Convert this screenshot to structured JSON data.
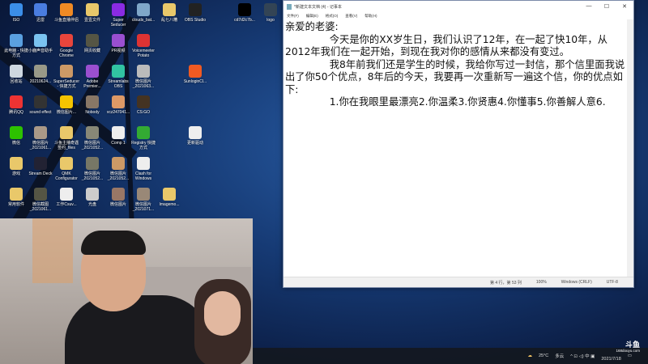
{
  "desktop": {
    "icons": [
      {
        "label": "ISO",
        "c": "#3b8ee8"
      },
      {
        "label": "迅雷",
        "c": "#4a7de0"
      },
      {
        "label": "斗鱼直播伴侣",
        "c": "#f08a24"
      },
      {
        "label": "壹壹文件",
        "c": "#e9c86a"
      },
      {
        "label": "Super Seducer",
        "c": "#8a2be2"
      },
      {
        "label": "clouds_bat...",
        "c": "#7fa7c9"
      },
      {
        "label": "乱七八糟",
        "c": "#e9c86a"
      },
      {
        "label": "OBS Studio",
        "c": "#222"
      },
      {
        "label": "cd7d2c7b...",
        "c": "#000"
      },
      {
        "label": "logo",
        "c": "#345"
      },
      {
        "label": "此电脑 - 快捷方式",
        "c": "#5aa0e0"
      },
      {
        "label": "小鹿声音助手",
        "c": "#7ac3f0"
      },
      {
        "label": "Google Chrome",
        "c": "#e8453c"
      },
      {
        "label": "网页收藏",
        "c": "#554"
      },
      {
        "label": "PR视频",
        "c": "#9a4fd0"
      },
      {
        "label": "Voicemeeter Potato",
        "c": "#d33"
      },
      {
        "label": "回收站",
        "c": "#cfd8e0"
      },
      {
        "label": "20210624...",
        "c": "#998"
      },
      {
        "label": "SuperSeducer - 快捷方式",
        "c": "#c96"
      },
      {
        "label": "Adobe Premier...",
        "c": "#9a4fd0"
      },
      {
        "label": "Streamlabs OBS",
        "c": "#31c3a2"
      },
      {
        "label": "微信图片_2021063...",
        "c": "#bbb"
      },
      {
        "label": "SunloginCl...",
        "c": "#f05a22"
      },
      {
        "label": "腾讯QQ",
        "c": "#e33"
      },
      {
        "label": "sound effect",
        "c": "#333"
      },
      {
        "label": "微信图片...",
        "c": "#f5c400"
      },
      {
        "label": "Nobody",
        "c": "#876"
      },
      {
        "label": "vcz247041...",
        "c": "#d96"
      },
      {
        "label": "CS:GO",
        "c": "#432"
      },
      {
        "label": "微信",
        "c": "#2dc100"
      },
      {
        "label": "微信图片_2021061...",
        "c": "#a98"
      },
      {
        "label": "斗鱼主播奇遇签约_files",
        "c": "#e9c86a"
      },
      {
        "label": "微信图片_2021052...",
        "c": "#887"
      },
      {
        "label": "Comp 1",
        "c": "#eee"
      },
      {
        "label": "Registry 快捷方式",
        "c": "#3a3"
      },
      {
        "label": "更新驱动",
        "c": "#eee"
      },
      {
        "label": "游戏",
        "c": "#e9c86a"
      },
      {
        "label": "Stream Deck",
        "c": "#223"
      },
      {
        "label": "QMK Configurator",
        "c": "#e9c86a"
      },
      {
        "label": "微信图片_2021052...",
        "c": "#776"
      },
      {
        "label": "微信图片_2021052...",
        "c": "#c96"
      },
      {
        "label": "Clash for Windows",
        "c": "#eee"
      },
      {
        "label": "常用软件",
        "c": "#e9c86a"
      },
      {
        "label": "微信截图_2021061...",
        "c": "#554"
      },
      {
        "label": "工作Csuv...",
        "c": "#eee"
      },
      {
        "label": "光盘",
        "c": "#ccc"
      },
      {
        "label": "微信图片",
        "c": "#976"
      },
      {
        "label": "微信图片_2021071...",
        "c": "#987"
      },
      {
        "label": "Imagemo...",
        "c": "#e9c86a"
      }
    ]
  },
  "notepad": {
    "title": "*新建文本文档 (4) - 记事本",
    "controls": {
      "minimize": "—",
      "maximize": "☐",
      "close": "✕"
    },
    "menu": [
      "文件(F)",
      "编辑(E)",
      "格式(O)",
      "查看(V)",
      "帮助(H)"
    ],
    "content": "亲爱的老婆:\n              今天是你的XX岁生日，我们认识了12年，在一起了快10年，从2012年我们在一起开始，到现在我对你的感情从来都没有变过。\n              我8年前我们还是学生的时候，我给你写过一封信，那个信里面我说出了你50个优点，8年后的今天，我要再一次重新写一遍这个信，你的优点如下:\n              1.你在我眼里最漂亮2.你温柔3.你贤惠4.你懂事5.你善解人意6.",
    "status": {
      "position": "第 4 行，第 53 列",
      "zoom": "100%",
      "eol": "Windows (CRLF)",
      "encoding": "UTF-8"
    }
  },
  "taskbar": {
    "weather_temp": "25°C",
    "weather_desc": "多云",
    "tray": "^ ⊡ ◁) 中 ▣",
    "date": "2021/7/18"
  },
  "watermark": {
    "logo": "斗鱼",
    "room": "168douyu.com"
  }
}
